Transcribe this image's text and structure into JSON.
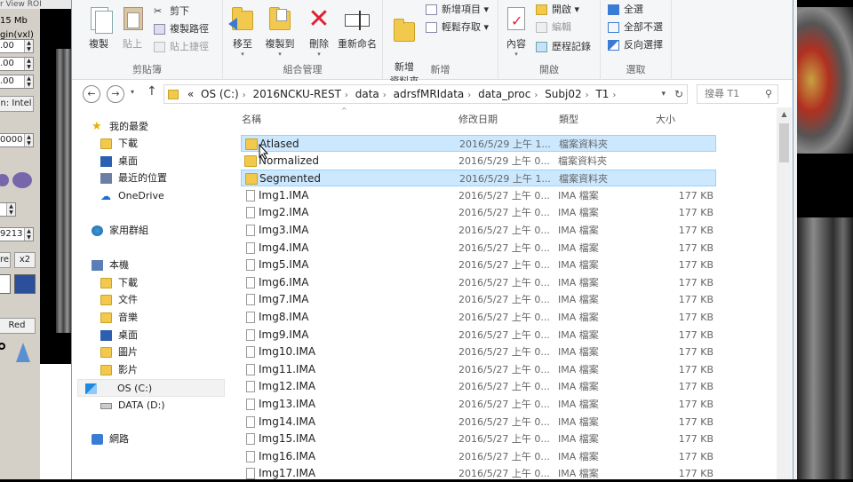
{
  "left_app": {
    "menu": "r  View  ROI",
    "mem": "15 Mb",
    "origin": "gin(vxl)",
    "v1": ".00",
    "v2": ".00",
    "v3": ".00",
    "format": "n: Intel",
    "v4": "0000",
    "v5": "9213",
    "btn_re": "re",
    "btn_x2": "x2",
    "btn_red": "Red"
  },
  "ribbon": {
    "clipboard": {
      "label": "剪貼簿",
      "copy": "複製",
      "paste": "貼上",
      "cut": "剪下",
      "copy_path": "複製路徑",
      "paste_shortcut": "貼上捷徑"
    },
    "organize": {
      "label": "組合管理",
      "move_to": "移至",
      "copy_to": "複製到",
      "delete": "刪除",
      "rename": "重新命名"
    },
    "new": {
      "label": "新增",
      "new_folder": "新增\n資料夾",
      "new_item": "新增項目 ▾",
      "easy_access": "輕鬆存取 ▾"
    },
    "open": {
      "label": "開啟",
      "properties": "內容",
      "open": "開啟 ▾",
      "edit": "編輯",
      "history": "歷程記錄"
    },
    "select": {
      "label": "選取",
      "select_all": "全選",
      "select_none": "全部不選",
      "invert": "反向選擇"
    }
  },
  "address": {
    "back": "←",
    "forward": "→",
    "up": "↑",
    "segments": [
      "«",
      "OS (C:)",
      "2016NCKU-REST",
      "data",
      "adrsfMRIdata",
      "data_proc",
      "Subj02",
      "T1"
    ],
    "search_placeholder": "搜尋 T1"
  },
  "nav": {
    "favorites": "我的最愛",
    "downloads": "下載",
    "desktop": "桌面",
    "recent": "最近的位置",
    "onedrive": "OneDrive",
    "homegroup": "家用群組",
    "thispc": "本機",
    "pc_downloads": "下載",
    "documents": "文件",
    "music": "音樂",
    "pc_desktop": "桌面",
    "pictures": "圖片",
    "videos": "影片",
    "os_c": "OS (C:)",
    "data_d": "DATA (D:)",
    "network": "網路"
  },
  "columns": {
    "name": "名稱",
    "date": "修改日期",
    "type": "類型",
    "size": "大小"
  },
  "files": [
    {
      "name": "Atlased",
      "date": "2016/5/29 上午 1...",
      "type": "檔案資料夾",
      "size": "",
      "kind": "folder",
      "hl": true
    },
    {
      "name": "Normalized",
      "date": "2016/5/29 上午 0...",
      "type": "檔案資料夾",
      "size": "",
      "kind": "folder",
      "hl": false
    },
    {
      "name": "Segmented",
      "date": "2016/5/29 上午 1...",
      "type": "檔案資料夾",
      "size": "",
      "kind": "folder",
      "hl": true
    },
    {
      "name": "Img1.IMA",
      "date": "2016/5/27 上午 0...",
      "type": "IMA 檔案",
      "size": "177 KB",
      "kind": "file",
      "hl": false
    },
    {
      "name": "Img2.IMA",
      "date": "2016/5/27 上午 0...",
      "type": "IMA 檔案",
      "size": "177 KB",
      "kind": "file",
      "hl": false
    },
    {
      "name": "Img3.IMA",
      "date": "2016/5/27 上午 0...",
      "type": "IMA 檔案",
      "size": "177 KB",
      "kind": "file",
      "hl": false
    },
    {
      "name": "Img4.IMA",
      "date": "2016/5/27 上午 0...",
      "type": "IMA 檔案",
      "size": "177 KB",
      "kind": "file",
      "hl": false
    },
    {
      "name": "Img5.IMA",
      "date": "2016/5/27 上午 0...",
      "type": "IMA 檔案",
      "size": "177 KB",
      "kind": "file",
      "hl": false
    },
    {
      "name": "Img6.IMA",
      "date": "2016/5/27 上午 0...",
      "type": "IMA 檔案",
      "size": "177 KB",
      "kind": "file",
      "hl": false
    },
    {
      "name": "Img7.IMA",
      "date": "2016/5/27 上午 0...",
      "type": "IMA 檔案",
      "size": "177 KB",
      "kind": "file",
      "hl": false
    },
    {
      "name": "Img8.IMA",
      "date": "2016/5/27 上午 0...",
      "type": "IMA 檔案",
      "size": "177 KB",
      "kind": "file",
      "hl": false
    },
    {
      "name": "Img9.IMA",
      "date": "2016/5/27 上午 0...",
      "type": "IMA 檔案",
      "size": "177 KB",
      "kind": "file",
      "hl": false
    },
    {
      "name": "Img10.IMA",
      "date": "2016/5/27 上午 0...",
      "type": "IMA 檔案",
      "size": "177 KB",
      "kind": "file",
      "hl": false
    },
    {
      "name": "Img11.IMA",
      "date": "2016/5/27 上午 0...",
      "type": "IMA 檔案",
      "size": "177 KB",
      "kind": "file",
      "hl": false
    },
    {
      "name": "Img12.IMA",
      "date": "2016/5/27 上午 0...",
      "type": "IMA 檔案",
      "size": "177 KB",
      "kind": "file",
      "hl": false
    },
    {
      "name": "Img13.IMA",
      "date": "2016/5/27 上午 0...",
      "type": "IMA 檔案",
      "size": "177 KB",
      "kind": "file",
      "hl": false
    },
    {
      "name": "Img14.IMA",
      "date": "2016/5/27 上午 0...",
      "type": "IMA 檔案",
      "size": "177 KB",
      "kind": "file",
      "hl": false
    },
    {
      "name": "Img15.IMA",
      "date": "2016/5/27 上午 0...",
      "type": "IMA 檔案",
      "size": "177 KB",
      "kind": "file",
      "hl": false
    },
    {
      "name": "Img16.IMA",
      "date": "2016/5/27 上午 0...",
      "type": "IMA 檔案",
      "size": "177 KB",
      "kind": "file",
      "hl": false
    },
    {
      "name": "Img17.IMA",
      "date": "2016/5/27 上午 0...",
      "type": "IMA 檔案",
      "size": "177 KB",
      "kind": "file",
      "hl": false
    }
  ],
  "colors": {
    "highlight": "#cce8ff",
    "highlight_border": "#99d1ff",
    "folder": "#f2c94c"
  }
}
